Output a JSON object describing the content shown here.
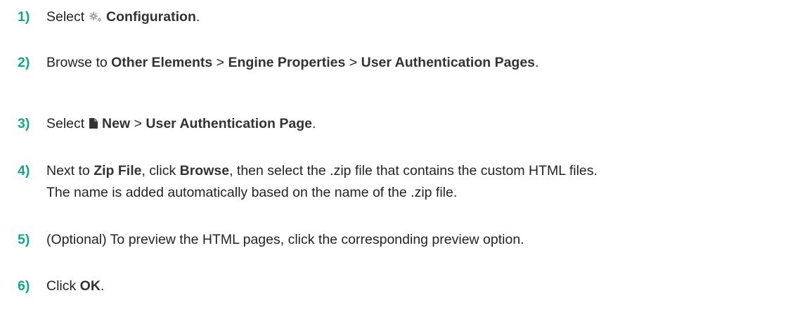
{
  "steps": [
    {
      "number": "1)",
      "parts": [
        {
          "t": "Select ",
          "b": false
        },
        {
          "icon": "gear-icon"
        },
        {
          "t": " ",
          "b": false
        },
        {
          "t": "Configuration",
          "b": true
        },
        {
          "t": ".",
          "b": false
        }
      ]
    },
    {
      "number": "2)",
      "parts": [
        {
          "t": "Browse to ",
          "b": false
        },
        {
          "t": "Other Elements",
          "b": true
        },
        {
          "t": " > ",
          "b": false
        },
        {
          "t": "Engine Properties",
          "b": true
        },
        {
          "t": " > ",
          "b": false
        },
        {
          "t": "User Authentication Pages",
          "b": true
        },
        {
          "t": ".",
          "b": false
        }
      ]
    },
    {
      "number": "3)",
      "parts": [
        {
          "t": "Select ",
          "b": false
        },
        {
          "icon": "new-document-icon"
        },
        {
          "t": " ",
          "b": false
        },
        {
          "t": "New",
          "b": true
        },
        {
          "t": " > ",
          "b": false
        },
        {
          "t": "User Authentication Page",
          "b": true
        },
        {
          "t": ".",
          "b": false
        }
      ]
    },
    {
      "number": "4)",
      "parts": [
        {
          "t": "Next to ",
          "b": false
        },
        {
          "t": "Zip File",
          "b": true
        },
        {
          "t": ", click ",
          "b": false
        },
        {
          "t": "Browse",
          "b": true
        },
        {
          "t": ", then select the .zip file that contains the custom HTML files.",
          "b": false
        },
        {
          "br": true
        },
        {
          "t": "The name is added automatically based on the name of the .zip file.",
          "b": false
        }
      ]
    },
    {
      "number": "5)",
      "parts": [
        {
          "t": "(Optional) To preview the HTML pages, click the corresponding preview option.",
          "b": false
        }
      ]
    },
    {
      "number": "6)",
      "parts": [
        {
          "t": "Click ",
          "b": false
        },
        {
          "t": "OK",
          "b": true
        },
        {
          "t": ".",
          "b": false
        }
      ]
    }
  ]
}
